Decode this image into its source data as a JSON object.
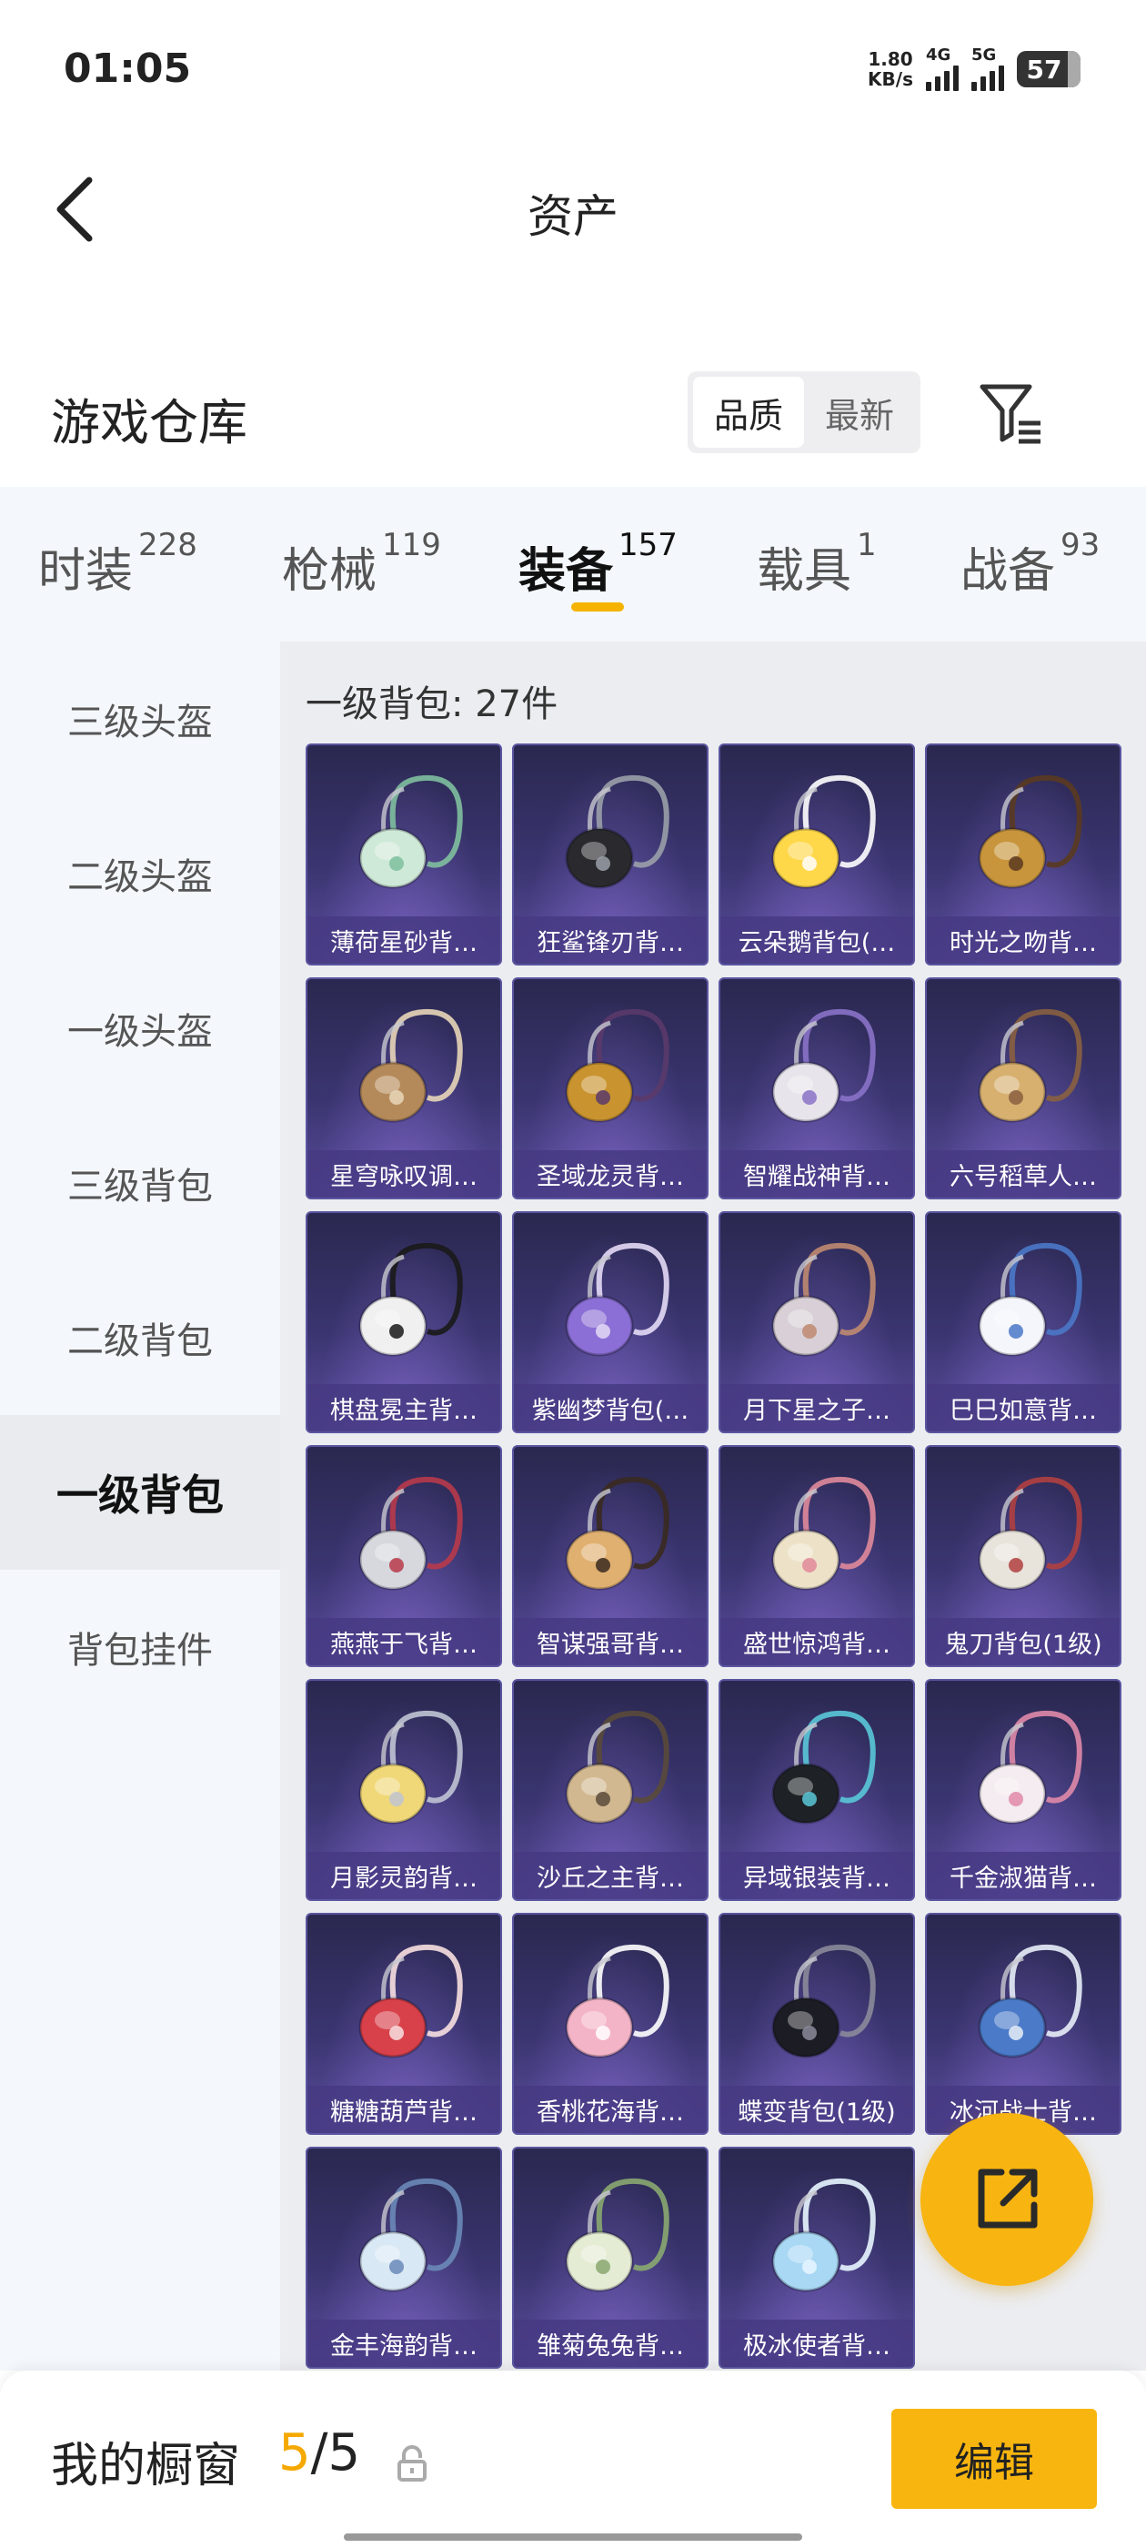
{
  "status": {
    "time": "01:05",
    "net_speed_value": "1.80",
    "net_speed_unit": "KB/s",
    "signal1": "4G",
    "signal2": "5G",
    "battery": "57"
  },
  "nav": {
    "title": "资产"
  },
  "section": {
    "title": "游戏仓库",
    "sort_options": [
      "品质",
      "最新"
    ],
    "active_sort": "品质"
  },
  "tabs": [
    {
      "label": "时装",
      "count": "228",
      "active": false
    },
    {
      "label": "枪械",
      "count": "119",
      "active": false
    },
    {
      "label": "装备",
      "count": "157",
      "active": true
    },
    {
      "label": "载具",
      "count": "1",
      "active": false
    },
    {
      "label": "战备",
      "count": "93",
      "active": false
    }
  ],
  "sidebar": [
    {
      "label": "三级头盔",
      "active": false
    },
    {
      "label": "二级头盔",
      "active": false
    },
    {
      "label": "一级头盔",
      "active": false
    },
    {
      "label": "三级背包",
      "active": false
    },
    {
      "label": "二级背包",
      "active": false
    },
    {
      "label": "一级背包",
      "active": true
    },
    {
      "label": "背包挂件",
      "active": false
    }
  ],
  "content": {
    "count_label": "一级背包: 27件",
    "items": [
      {
        "name": "薄荷星砂背…",
        "color": "#cfe9d8",
        "accent": "#7fbf9f"
      },
      {
        "name": "狂鲨锋刃背…",
        "color": "#2a2a2e",
        "accent": "#9aa0a8"
      },
      {
        "name": "云朵鹅背包(…",
        "color": "#ffd84a",
        "accent": "#ffffff"
      },
      {
        "name": "时光之吻背…",
        "color": "#c8953c",
        "accent": "#5a3a20"
      },
      {
        "name": "星穹咏叹调…",
        "color": "#b58a5a",
        "accent": "#e8d6b8"
      },
      {
        "name": "圣域龙灵背…",
        "color": "#c9932f",
        "accent": "#5a3a6a"
      },
      {
        "name": "智耀战神背…",
        "color": "#e8e4ec",
        "accent": "#8a72c8"
      },
      {
        "name": "六号稻草人…",
        "color": "#d7b070",
        "accent": "#8a6040"
      },
      {
        "name": "棋盘冕主背…",
        "color": "#f0f0f0",
        "accent": "#1a1a1a"
      },
      {
        "name": "紫幽梦背包(…",
        "color": "#8b6fd6",
        "accent": "#e4daf6"
      },
      {
        "name": "月下星之子…",
        "color": "#d8d0d6",
        "accent": "#c08a70"
      },
      {
        "name": "巳巳如意背…",
        "color": "#f4f6fb",
        "accent": "#4a78c8"
      },
      {
        "name": "燕燕于飞背…",
        "color": "#d6d8de",
        "accent": "#b83a4a"
      },
      {
        "name": "智谋强哥背…",
        "color": "#e0b070",
        "accent": "#3a2a20"
      },
      {
        "name": "盛世惊鸿背…",
        "color": "#ede2c8",
        "accent": "#e08a9a"
      },
      {
        "name": "鬼刀背包(1级)",
        "color": "#e8e4dc",
        "accent": "#b04040"
      },
      {
        "name": "月影灵韵背…",
        "color": "#f0d878",
        "accent": "#c0c4d4"
      },
      {
        "name": "沙丘之主背…",
        "color": "#d2b890",
        "accent": "#5a4a3a"
      },
      {
        "name": "异域银装背…",
        "color": "#1e2226",
        "accent": "#5ac8d8"
      },
      {
        "name": "千金淑猫背…",
        "color": "#f4ecf0",
        "accent": "#e08aa8"
      },
      {
        "name": "糖糖葫芦背…",
        "color": "#d8404a",
        "accent": "#f8e0e0"
      },
      {
        "name": "香桃花海背…",
        "color": "#f4b4c8",
        "accent": "#ffffff"
      },
      {
        "name": "蝶变背包(1级)",
        "color": "#1c1c24",
        "accent": "#8a8a9a"
      },
      {
        "name": "冰河战士背…",
        "color": "#4a7ac8",
        "accent": "#e8eef8"
      },
      {
        "name": "金丰海韵背…",
        "color": "#d8e8f4",
        "accent": "#6a8ab8"
      },
      {
        "name": "雏菊兔兔背…",
        "color": "#e4ecd4",
        "accent": "#8aa870"
      },
      {
        "name": "极冰使者背…",
        "color": "#a8d8f4",
        "accent": "#e8f6ff"
      }
    ]
  },
  "bottom": {
    "title": "我的橱窗",
    "current": "5",
    "total": "/5",
    "edit_label": "编辑"
  },
  "colors": {
    "accent": "#f5b300",
    "card_bg": "#3a3570"
  }
}
